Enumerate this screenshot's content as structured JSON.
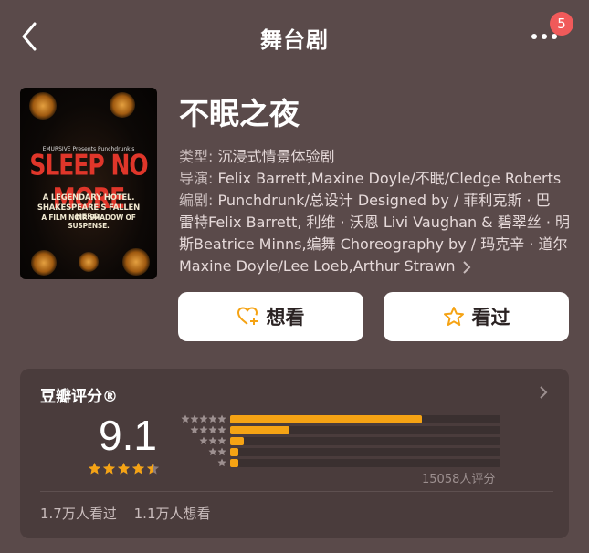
{
  "nav": {
    "title": "舞台剧",
    "badge": "5"
  },
  "poster": {
    "presenter": "EMURSIVE Presents Punchdrunk's",
    "brand": "SLEEP NO MORE",
    "tag_lines": [
      "A LEGENDARY HOTEL.",
      "SHAKESPEARE'S FALLEN HERO.",
      "A FILM NOIR SHADOW OF SUSPENSE."
    ]
  },
  "show": {
    "title": "不眠之夜",
    "type_label": "类型:",
    "type_value": "沉浸式情景体验剧",
    "director_label": "导演:",
    "director_value": "Felix Barrett,Maxine Doyle/不眠/Cledge Roberts",
    "writer_label": "编剧:",
    "writer_line1": "Punchdrunk/总设计 Designed by / 菲利克斯 · 巴",
    "writer_line2": "雷特Felix Barrett, 利维 · 沃恩 Livi Vaughan & 碧翠丝 · 明",
    "writer_line3": "斯Beatrice Minns,编舞 Choreography by / 玛克辛 · 道尔",
    "writer_line4": "Maxine Doyle/Lee Loeb,Arthur Strawn"
  },
  "actions": {
    "want_label": "想看",
    "seen_label": "看过"
  },
  "rating": {
    "title": "豆瓣评分®",
    "score": "9.1",
    "star_value": 4.5,
    "count_text": "15058人评分",
    "distribution": [
      0.71,
      0.22,
      0.05,
      0.03,
      0.03
    ],
    "seen_text": "1.7万人看过",
    "want_text": "1.1万人想看"
  },
  "colors": {
    "accent": "#f5a314",
    "badge": "#f05a5a",
    "background": "#5a4a4a",
    "card": "#4a3c3c"
  }
}
